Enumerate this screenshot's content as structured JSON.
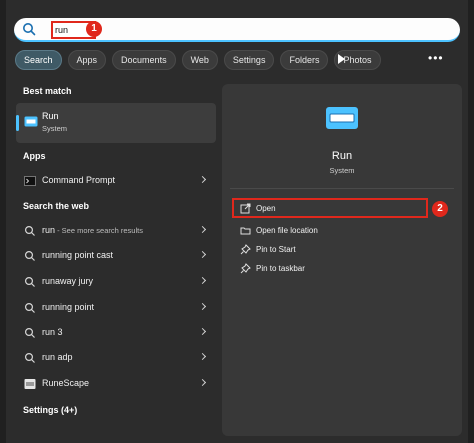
{
  "search": {
    "query": "run",
    "badge": "1"
  },
  "tabs": [
    "Search",
    "Apps",
    "Documents",
    "Web",
    "Settings",
    "Folders",
    "Photos"
  ],
  "more_label": "•••",
  "best_match": {
    "heading": "Best match",
    "title": "Run",
    "subtitle": "System"
  },
  "apps": {
    "heading": "Apps",
    "items": [
      {
        "label": "Command Prompt"
      }
    ]
  },
  "web": {
    "heading": "Search the web",
    "items": [
      {
        "label": "run",
        "hint": " - See more search results"
      },
      {
        "label": "running point cast"
      },
      {
        "label": "runaway jury"
      },
      {
        "label": "running point"
      },
      {
        "label": "run 3"
      },
      {
        "label": "run adp"
      },
      {
        "label": "RuneScape"
      }
    ]
  },
  "settings_line": "Settings (4+)",
  "detail": {
    "title": "Run",
    "subtitle": "System",
    "badge": "2",
    "actions": [
      "Open",
      "Open file location",
      "Pin to Start",
      "Pin to taskbar"
    ]
  },
  "colors": {
    "accent": "#4cc2ff",
    "highlight": "#e0281c",
    "panel": "#383838"
  }
}
